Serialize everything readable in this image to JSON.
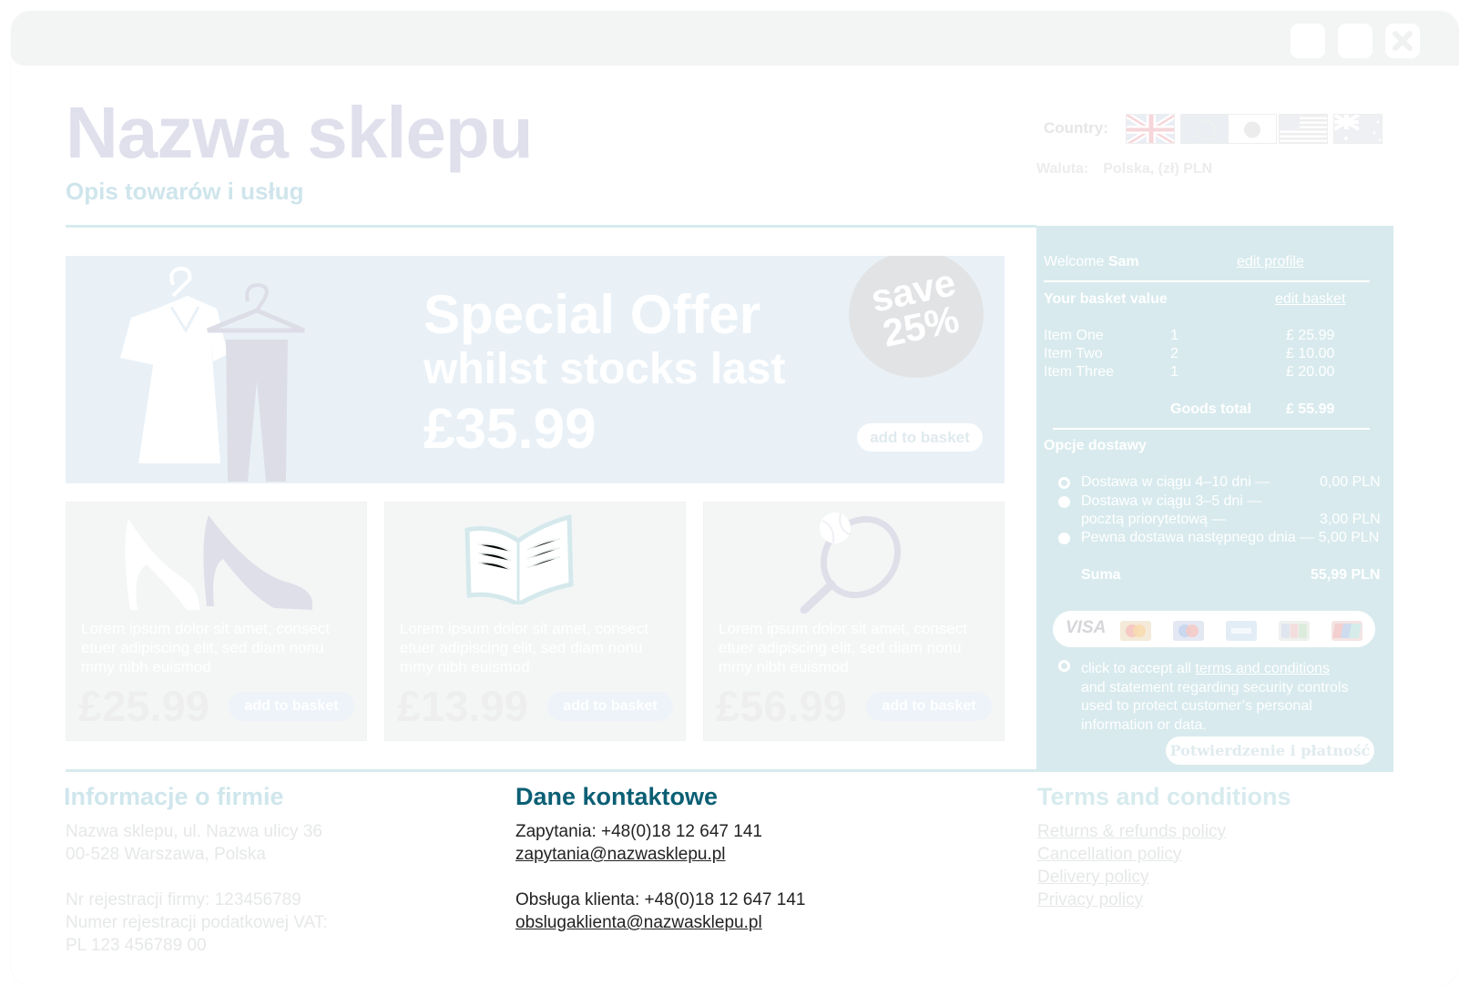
{
  "header": {
    "shop_name": "Nazwa sklepu",
    "shop_tagline": "Opis towarów i usług",
    "country_label": "Country:",
    "flags": [
      "uk-flag-icon",
      "eu-flag-icon",
      "japan-flag-icon",
      "usa-flag-icon",
      "australia-flag-icon"
    ],
    "currency_label": "Waluta:",
    "currency_value": "Polska, (zł) PLN"
  },
  "banner": {
    "title": "Special Offer",
    "subtitle": "whilst stocks last",
    "price": "£35.99",
    "save_line1": "save",
    "save_line2": "25%",
    "button": "add to basket"
  },
  "products": [
    {
      "icon": "high-heels-icon",
      "desc": "Lorem ipsum dolor sit amet, consect etuer adipiscing elit, sed diam nonu mmy nibh euismod",
      "price": "£25.99",
      "button": "add to basket"
    },
    {
      "icon": "open-book-icon",
      "desc": "Lorem ipsum dolor sit amet, consect etuer adipiscing elit, sed diam nonu mmy nibh euismod",
      "price": "£13.99",
      "button": "add to basket"
    },
    {
      "icon": "tennis-racket-icon",
      "desc": "Lorem ipsum dolor sit amet, consect etuer adipiscing elit, sed diam nonu mmy nibh euismod",
      "price": "£56.99",
      "button": "add to basket"
    }
  ],
  "basket": {
    "welcome": "Welcome",
    "user": "Sam",
    "edit_profile": "edit profile",
    "basket_value_label": "Your basket value",
    "edit_basket": "edit basket",
    "items": [
      {
        "name": "Item One",
        "qty": "1",
        "price": "£ 25.99"
      },
      {
        "name": "Item Two",
        "qty": "2",
        "price": "£ 10.00"
      },
      {
        "name": "Item Three",
        "qty": "1",
        "price": "£ 20.00"
      }
    ],
    "goods_total_label": "Goods total",
    "goods_total": "£ 55.99",
    "delivery_title": "Opcje dostawy",
    "delivery": [
      {
        "line1": "Dostawa w ciągu 4–10 dni —",
        "line2": "",
        "price": "0,00 PLN",
        "selected": true
      },
      {
        "line1": "Dostawa w ciągu 3–5 dni —",
        "line2": "pocztą priorytetową  —",
        "price": "3,00 PLN",
        "selected": false
      },
      {
        "line1": "Pewna dostawa następnego dnia — 5,00 PLN",
        "line2": "",
        "price": "",
        "selected": false
      }
    ],
    "sum_label": "Suma",
    "sum_value": "55,99 PLN",
    "payment_cards": [
      "visa-icon",
      "mastercard-icon",
      "maestro-icon",
      "amex-icon",
      "jcb-icon",
      "unionpay-icon"
    ],
    "visa_text": "VISA",
    "terms_prefix": "click to accept all",
    "terms_link": "terms and conditions",
    "terms_line2": "and statement regarding security controls",
    "terms_line3": "used to protect customer’s personal",
    "terms_line4": "information or data.",
    "confirm_button": "Potwierdzenie i płatność"
  },
  "footer": {
    "company": {
      "title": "Informacje o firmie",
      "line1": "Nazwa sklepu, ul. Nazwa ulicy 36",
      "line2": "00-528 Warszawa, Polska",
      "line3": "Nr rejestracji firmy: 123456789",
      "line4": "Numer rejestracji podatkowej VAT:",
      "line5": "PL 123 456789 00"
    },
    "contact": {
      "title": "Dane kontaktowe",
      "inquiries": "Zapytania: +48(0)18 12 647 141",
      "inquiries_email": "zapytania@nazwasklepu.pl",
      "service": "Obsługa klienta: +48(0)18 12 647 141",
      "service_email": "obslugaklienta@nazwasklepu.pl"
    },
    "terms": {
      "title": "Terms and conditions",
      "links": [
        "Returns & refunds policy",
        "Cancellation policy",
        "Delivery policy",
        "Privacy policy"
      ]
    }
  },
  "colors": {
    "accent": "#d8eaed",
    "banner_bg": "#e9f1f7",
    "contact_title": "#0b5f74",
    "title_faded": "#dfe0ec"
  }
}
